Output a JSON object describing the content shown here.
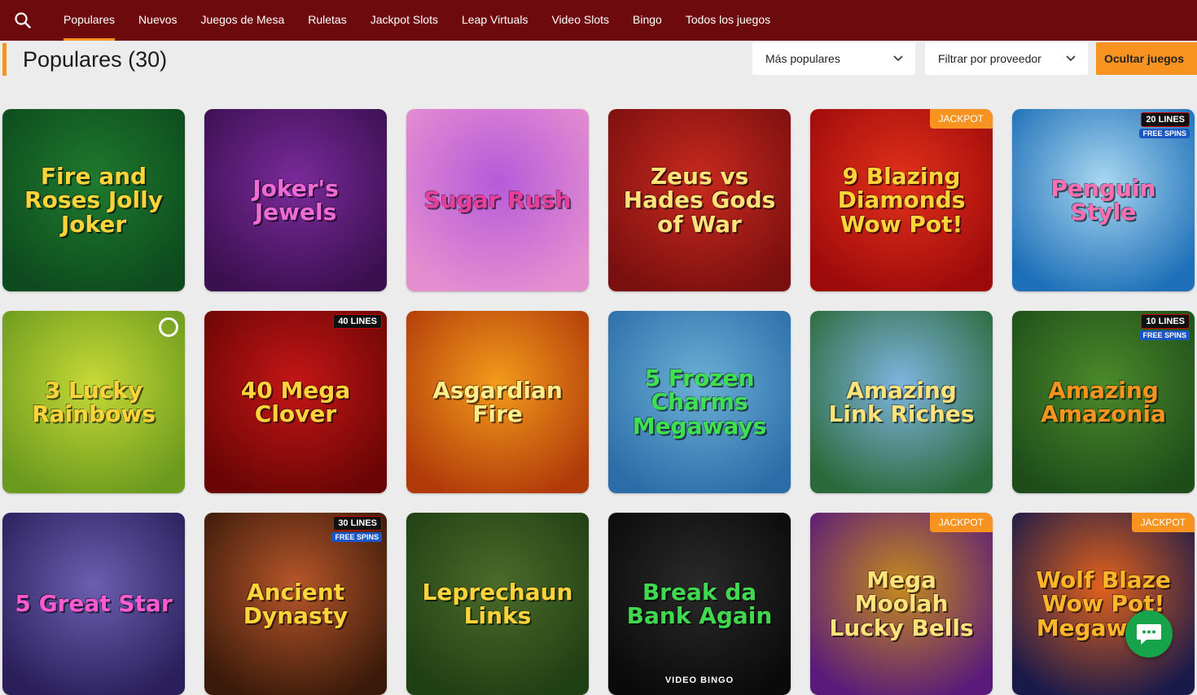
{
  "nav": {
    "search_icon": "search-icon",
    "tabs": [
      {
        "label": "Populares",
        "active": true
      },
      {
        "label": "Nuevos"
      },
      {
        "label": "Juegos de Mesa"
      },
      {
        "label": "Ruletas"
      },
      {
        "label": "Jackpot Slots"
      },
      {
        "label": "Leap Virtuals"
      },
      {
        "label": "Video Slots"
      },
      {
        "label": "Bingo"
      },
      {
        "label": "Todos los juegos"
      }
    ]
  },
  "header": {
    "title": "Populares (30)",
    "sort_select": "Más populares",
    "provider_select": "Filtrar por proveedor",
    "hide_button": "Ocultar juegos"
  },
  "colors": {
    "nav_bg": "#6d0a0e",
    "accent": "#f7931e",
    "page_bg": "#ececec",
    "chat": "#16a34a"
  },
  "games": [
    {
      "title": "Fire and Roses Jolly Joker",
      "bg1": "#0d4a1e",
      "bg2": "#1f7a2e",
      "fg": "#ffd43b"
    },
    {
      "title": "Joker's Jewels",
      "bg1": "#3a1050",
      "bg2": "#7a2a9a",
      "fg": "#f06bd6"
    },
    {
      "title": "Sugar Rush",
      "bg1": "#e58fd0",
      "bg2": "#b65bd9",
      "fg": "#e83f9c"
    },
    {
      "title": "Zeus vs Hades Gods of War",
      "bg1": "#7a0f0f",
      "bg2": "#c92a1e",
      "fg": "#ffe27a"
    },
    {
      "title": "9 Blazing Diamonds Wow Pot!",
      "bg1": "#9d0a0a",
      "bg2": "#e2311b",
      "fg": "#ffd43b",
      "jackpot": "JACKPOT"
    },
    {
      "title": "Penguin Style",
      "bg1": "#1c6fb8",
      "bg2": "#a9d7f0",
      "fg": "#ff6fb1",
      "lines": "20 LINES",
      "free": "FREE SPINS"
    },
    {
      "title": "3 Lucky Rainbows",
      "bg1": "#6a9a1e",
      "bg2": "#c7d936",
      "fg": "#ffd43b",
      "provider": true
    },
    {
      "title": "40 Mega Clover",
      "bg1": "#6a0505",
      "bg2": "#c41616",
      "fg": "#ffd43b",
      "lines": "40 LINES"
    },
    {
      "title": "Asgardian Fire",
      "bg1": "#b13a0a",
      "bg2": "#f39b1b",
      "fg": "#ffec8a"
    },
    {
      "title": "5 Frozen Charms Megaways",
      "bg1": "#2b6da8",
      "bg2": "#6bb0d6",
      "fg": "#3fe04f"
    },
    {
      "title": "Amazing Link Riches",
      "bg1": "#2a6a3a",
      "bg2": "#7fb4e0",
      "fg": "#ffe27a"
    },
    {
      "title": "Amazing Amazonia",
      "bg1": "#1e4d1a",
      "bg2": "#4b8a2a",
      "fg": "#f7931e",
      "lines": "10 LINES",
      "free": "FREE SPINS"
    },
    {
      "title": "5 Great Star",
      "bg1": "#2a1f5a",
      "bg2": "#6b5fb0",
      "fg": "#ff5ad1"
    },
    {
      "title": "Ancient Dynasty",
      "bg1": "#3a1a0a",
      "bg2": "#b7562a",
      "fg": "#ffd43b",
      "lines": "30 LINES",
      "free": "FREE SPINS"
    },
    {
      "title": "Leprechaun Links",
      "bg1": "#1f3f14",
      "bg2": "#4b6b2a",
      "fg": "#ffd43b"
    },
    {
      "title": "Break da Bank Again",
      "bg1": "#0a0a0a",
      "bg2": "#2a2a2a",
      "fg": "#3fd84f",
      "sub": "VIDEO BINGO"
    },
    {
      "title": "Mega Moolah Lucky Bells",
      "bg1": "#5a1a7a",
      "bg2": "#c48a1e",
      "fg": "#ffe27a",
      "jackpot": "JACKPOT"
    },
    {
      "title": "Wolf Blaze Wow Pot! Megaways",
      "bg1": "#1a1a4a",
      "bg2": "#e2621b",
      "fg": "#ffb52a",
      "jackpot": "JACKPOT"
    }
  ],
  "chat": {
    "icon": "chat-icon"
  }
}
